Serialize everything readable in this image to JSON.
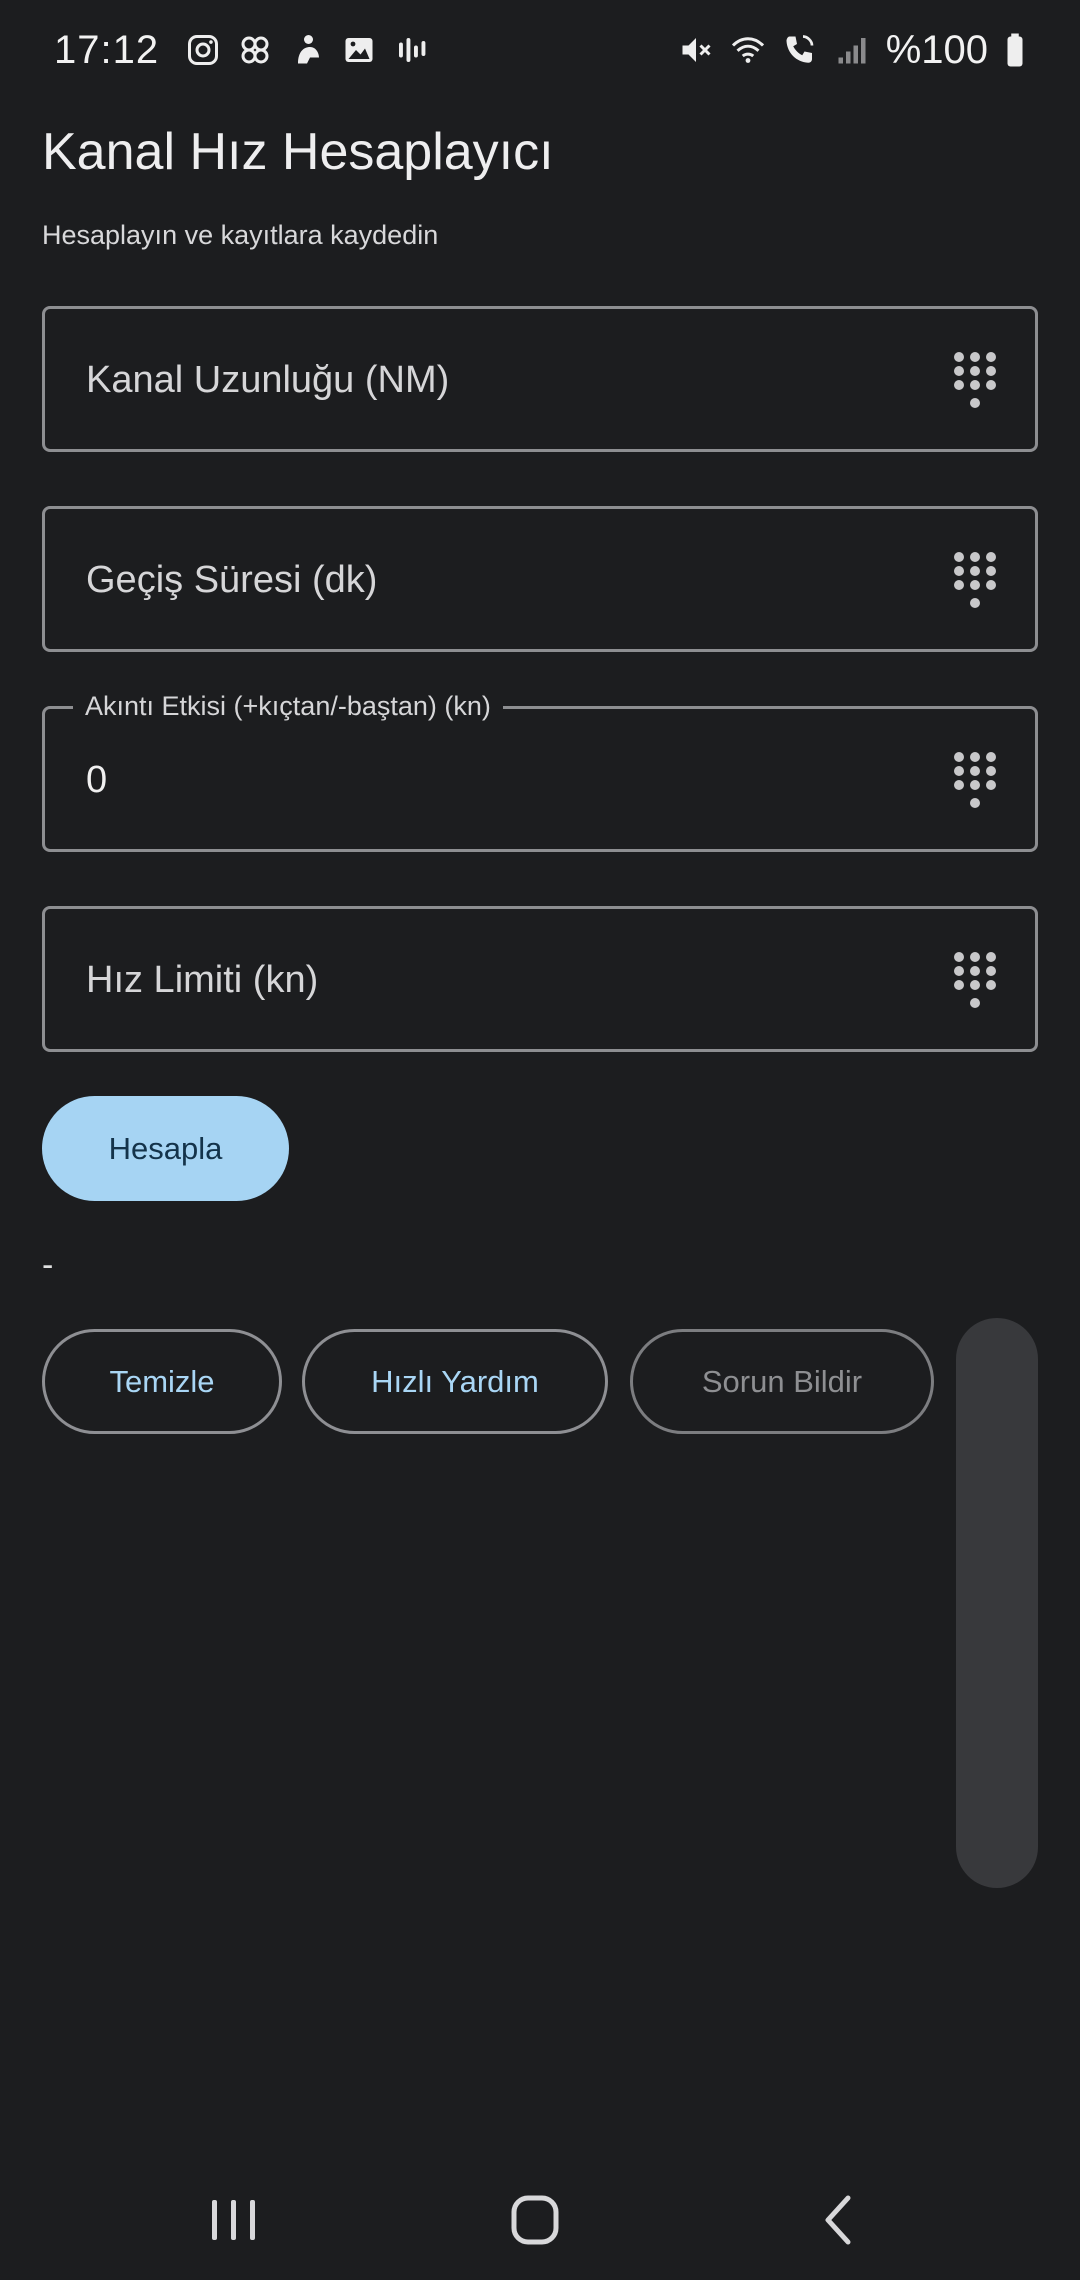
{
  "status_bar": {
    "time": "17:12",
    "notification_icons": [
      "instagram-icon",
      "pinwheel-icon",
      "figure-icon",
      "gallery-icon",
      "sound-bars-icon"
    ],
    "system_icons": [
      "mute-icon",
      "wifi-icon",
      "wifi-call-icon",
      "signal-icon",
      "battery-icon"
    ],
    "battery": "%100"
  },
  "header": {
    "title": "Kanal Hız Hesaplayıcı",
    "subtitle": "Hesaplayın ve kayıtlara kaydedin"
  },
  "form": {
    "fields": [
      {
        "placeholder": "Kanal Uzunluğu (NM)",
        "value": "",
        "icon": "keypad-icon"
      },
      {
        "placeholder": "Geçiş Süresi (dk)",
        "value": "",
        "icon": "keypad-icon"
      },
      {
        "label": "Akıntı Etkisi (+kıçtan/-baştan) (kn)",
        "value": "0",
        "icon": "keypad-icon"
      },
      {
        "placeholder": "Hız Limiti (kn)",
        "value": "",
        "icon": "keypad-icon"
      }
    ],
    "calculate_label": "Hesapla",
    "result": "-"
  },
  "actions": {
    "clear_label": "Temizle",
    "help_label": "Hızlı Yardım",
    "report_label": "Sorun Bildir"
  },
  "nav_bar": {
    "recents_icon": "recents-icon",
    "home_icon": "home-icon",
    "back_icon": "back-icon"
  },
  "colors": {
    "background": "#1c1d1f",
    "accent": "#a6d4f3",
    "accent_text": "#a9d6f5",
    "outline": "#8d8e91",
    "disabled_text": "#8e8f92"
  }
}
